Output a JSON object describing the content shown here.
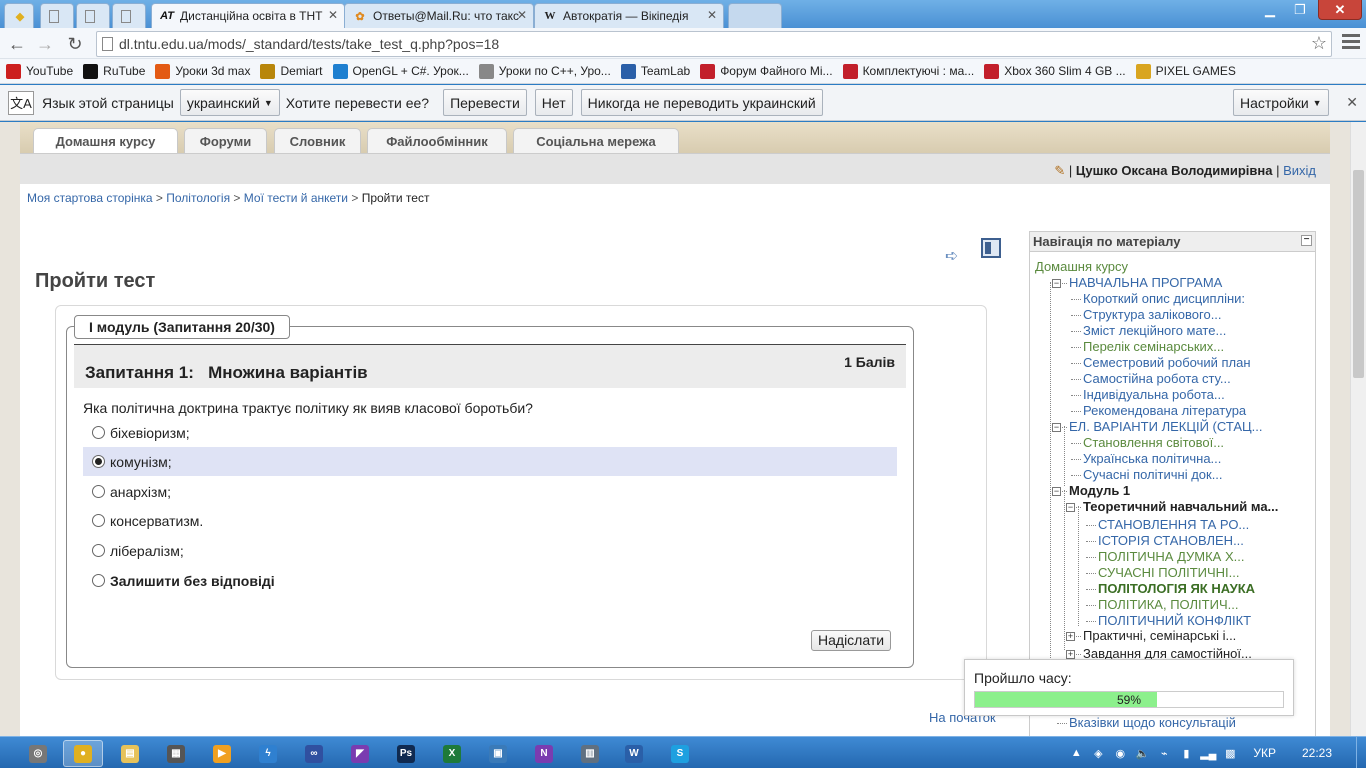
{
  "browser": {
    "tabs": [
      {
        "label": "",
        "icon": "bookmark-icon"
      },
      {
        "label": "",
        "icon": "page-icon"
      },
      {
        "label": "",
        "icon": "page-icon"
      },
      {
        "label": "",
        "icon": "page-icon"
      },
      {
        "label": "Дистанційна освіта в ТНТ",
        "icon": "AT",
        "active": true
      },
      {
        "label": "Ответы@Mail.Ru: что такс",
        "icon": "mailru-icon"
      },
      {
        "label": "Автократія — Вікіпедія",
        "icon": "W"
      }
    ],
    "url": "dl.tntu.edu.ua/mods/_standard/tests/take_test_q.php?pos=18",
    "bookmarks": [
      {
        "label": "YouTube",
        "color": "#cc1f1f",
        "icon": "youtube-icon"
      },
      {
        "label": "RuTube",
        "color": "#111111",
        "icon": "play-icon"
      },
      {
        "label": "Уроки 3d max",
        "color": "#e35a14",
        "icon": "3dmax-icon"
      },
      {
        "label": "Demiart",
        "color": "#b8860b",
        "icon": "demiart-icon"
      },
      {
        "label": "OpenGL + C#. Урок...",
        "color": "#1e7fd0",
        "icon": "check-icon"
      },
      {
        "label": "Уроки по C++, Уро...",
        "color": "#888888",
        "icon": "page-icon"
      },
      {
        "label": "TeamLab",
        "color": "#2a5fa8",
        "icon": "teamlab-icon"
      },
      {
        "label": "Форум Файного Мі...",
        "color": "#c21f2b",
        "icon": "forum-icon"
      },
      {
        "label": "Комплектуючі : ма...",
        "color": "#c21f2b",
        "icon": "forum-icon"
      },
      {
        "label": "Xbox 360 Slim 4 GB ...",
        "color": "#c21f2b",
        "icon": "forum-icon"
      },
      {
        "label": "PIXEL GAMES",
        "color": "#d9a520",
        "icon": "folder-icon"
      }
    ],
    "translate": {
      "prompt": "Язык этой страницы",
      "language": "украинский",
      "question": "Хотите перевести ее?",
      "translate_btn": "Перевести",
      "no_btn": "Нет",
      "never_btn": "Никогда не переводить украинский",
      "settings_btn": "Настройки"
    }
  },
  "site": {
    "nav_tabs": [
      "Домашня курсу",
      "Форуми",
      "Словник",
      "Файлообмінник",
      "Соціальна мережа"
    ],
    "user_name": "Цушко Оксана Володимирівна",
    "logout": "Вихід",
    "breadcrumb": [
      "Моя стартова сторінка",
      "Політологія",
      "Мої тести й анкети"
    ],
    "breadcrumb_current": "Пройти тест",
    "page_title": "Пройти тест",
    "module_legend": "І модуль (Запитання 20/30)",
    "question": {
      "number_label": "Запитання 1:",
      "type_label": "Множина варіантів",
      "points": "1 Балів",
      "text": "Яка політична доктрина трактує політику як вияв класової боротьби?",
      "options": [
        {
          "label": "біхевіоризм;",
          "selected": false
        },
        {
          "label": "комунізм;",
          "selected": true
        },
        {
          "label": "анархізм;",
          "selected": false
        },
        {
          "label": "консерватизм.",
          "selected": false
        },
        {
          "label": "лібералізм;",
          "selected": false
        },
        {
          "label": "Залишити без відповіді",
          "selected": false,
          "bold": true
        }
      ],
      "submit": "Надіслати"
    },
    "to_top": "На початок",
    "sidebar": {
      "title": "Навігація по матеріалу",
      "home": "Домашня курсу",
      "items": {
        "program": "НАВЧАЛЬНА ПРОГРАМА",
        "p1": "Короткий опис дисципліни:",
        "p2": "Структура залікового...",
        "p3": "Зміст лекційного мате...",
        "p4": "Перелік семінарських...",
        "p5": "Семестровий робочий план",
        "p6": "Самостійна робота сту...",
        "p7": "Індивідуальна робота...",
        "p8": "Рекомендована література",
        "lectures": "ЕЛ. ВАРІАНТИ ЛЕКЦІЙ (СТАЦ...",
        "l1": "Становлення світової...",
        "l2": "Українська політична...",
        "l3": "Сучасні політичні док...",
        "module": "Модуль 1",
        "theory": "Теоретичний навчальний ма...",
        "t1": "СТАНОВЛЕННЯ ТА РО...",
        "t2": "ІСТОРІЯ СТАНОВЛЕН...",
        "t3": "ПОЛІТИЧНА ДУМКА Х...",
        "t4": "СУЧАСНІ ПОЛІТИЧНІ...",
        "t5": "ПОЛІТОЛОГІЯ ЯК НАУКА",
        "t6": "ПОЛІТИКА, ПОЛІТИЧ...",
        "t7": "ПОЛІТИЧНИЙ КОНФЛІКТ",
        "practice": "Практичні, семінарські і...",
        "tasks": "Завдання для самостійної...",
        "consult": "Вказівки щодо консультацій"
      }
    },
    "timer": {
      "label": "Пройшло часу:",
      "percent_text": "59%",
      "progress": 0.59
    }
  },
  "taskbar": {
    "clock": "22:23",
    "lang": "УКР",
    "apps": [
      {
        "name": "show-desktop",
        "color": "#777777",
        "glyph": "◎"
      },
      {
        "name": "chrome",
        "color": "#e0b020",
        "glyph": "●"
      },
      {
        "name": "explorer",
        "color": "#e6c25a",
        "glyph": "▤"
      },
      {
        "name": "film",
        "color": "#555555",
        "glyph": "▦"
      },
      {
        "name": "media",
        "color": "#f0a020",
        "glyph": "▶"
      },
      {
        "name": "lightning",
        "color": "#2f80d0",
        "glyph": "ϟ"
      },
      {
        "name": "link",
        "color": "#3050a0",
        "glyph": "∞"
      },
      {
        "name": "visual-studio",
        "color": "#7a3cb0",
        "glyph": "◤"
      },
      {
        "name": "photoshop",
        "color": "#102a50",
        "glyph": "Ps"
      },
      {
        "name": "excel-app",
        "color": "#1e7a3a",
        "glyph": "X"
      },
      {
        "name": "network",
        "color": "#3a7ab8",
        "glyph": "▣"
      },
      {
        "name": "onenote",
        "color": "#7a3cb0",
        "glyph": "N"
      },
      {
        "name": "calculator",
        "color": "#607080",
        "glyph": "▥"
      },
      {
        "name": "word",
        "color": "#2a5fa8",
        "glyph": "W"
      },
      {
        "name": "skype",
        "color": "#1ea0e0",
        "glyph": "S"
      }
    ]
  }
}
